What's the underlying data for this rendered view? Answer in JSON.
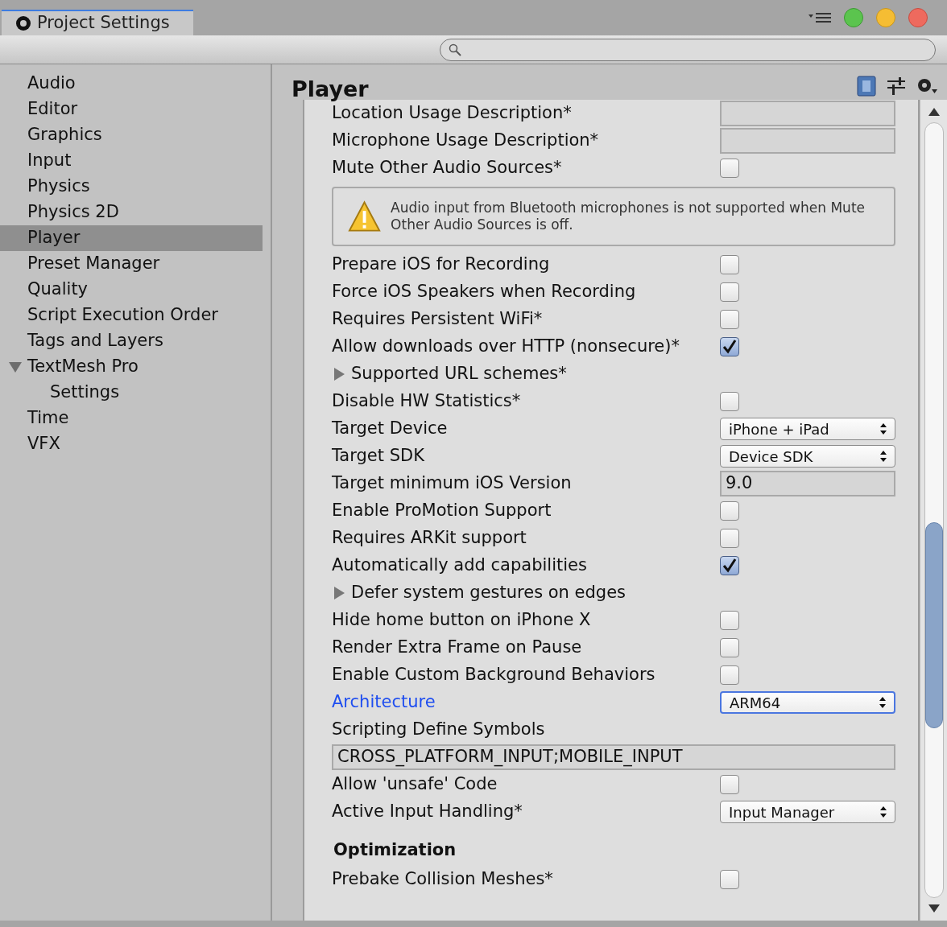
{
  "window": {
    "title": "Project Settings"
  },
  "sidebar": {
    "items": [
      {
        "label": "Audio",
        "selected": false
      },
      {
        "label": "Editor",
        "selected": false
      },
      {
        "label": "Graphics",
        "selected": false
      },
      {
        "label": "Input",
        "selected": false
      },
      {
        "label": "Physics",
        "selected": false
      },
      {
        "label": "Physics 2D",
        "selected": false
      },
      {
        "label": "Player",
        "selected": true
      },
      {
        "label": "Preset Manager",
        "selected": false
      },
      {
        "label": "Quality",
        "selected": false
      },
      {
        "label": "Script Execution Order",
        "selected": false
      },
      {
        "label": "Tags and Layers",
        "selected": false
      },
      {
        "label": "TextMesh Pro",
        "selected": false,
        "expanded": true,
        "children": [
          {
            "label": "Settings",
            "selected": false
          }
        ]
      },
      {
        "label": "Time",
        "selected": false
      },
      {
        "label": "VFX",
        "selected": false
      }
    ]
  },
  "panel": {
    "title": "Player",
    "rows": [
      {
        "kind": "field",
        "label": "Location Usage Description*",
        "value": ""
      },
      {
        "kind": "field",
        "label": "Microphone Usage Description*",
        "value": ""
      },
      {
        "kind": "checkbox",
        "label": "Mute Other Audio Sources*",
        "checked": false
      },
      {
        "kind": "warning",
        "text": "Audio input from Bluetooth microphones is not supported when Mute Other Audio Sources is off."
      },
      {
        "kind": "checkbox",
        "label": "Prepare iOS for Recording",
        "checked": false
      },
      {
        "kind": "checkbox",
        "label": "Force iOS Speakers when Recording",
        "checked": false
      },
      {
        "kind": "checkbox",
        "label": "Requires Persistent WiFi*",
        "checked": false
      },
      {
        "kind": "checkbox",
        "label": "Allow downloads over HTTP (nonsecure)*",
        "checked": true
      },
      {
        "kind": "foldout",
        "label": "Supported URL schemes*",
        "expanded": false
      },
      {
        "kind": "checkbox",
        "label": "Disable HW Statistics*",
        "checked": false
      },
      {
        "kind": "dropdown",
        "label": "Target Device",
        "value": "iPhone + iPad",
        "focused": false
      },
      {
        "kind": "dropdown",
        "label": "Target SDK",
        "value": "Device SDK",
        "focused": false
      },
      {
        "kind": "field",
        "label": "Target minimum iOS Version",
        "value": "9.0"
      },
      {
        "kind": "checkbox",
        "label": "Enable ProMotion Support",
        "checked": false
      },
      {
        "kind": "checkbox",
        "label": "Requires ARKit support",
        "checked": false
      },
      {
        "kind": "checkbox",
        "label": "Automatically add capabilities",
        "checked": true
      },
      {
        "kind": "foldout",
        "label": "Defer system gestures on edges",
        "expanded": false
      },
      {
        "kind": "checkbox",
        "label": "Hide home button on iPhone X",
        "checked": false
      },
      {
        "kind": "checkbox",
        "label": "Render Extra Frame on Pause",
        "checked": false
      },
      {
        "kind": "checkbox",
        "label": "Enable Custom Background Behaviors",
        "checked": false
      },
      {
        "kind": "dropdown",
        "label": "Architecture",
        "value": "ARM64",
        "focused": true
      },
      {
        "kind": "label",
        "label": "Scripting Define Symbols"
      },
      {
        "kind": "wide_field",
        "value": "CROSS_PLATFORM_INPUT;MOBILE_INPUT"
      },
      {
        "kind": "checkbox",
        "label": "Allow 'unsafe' Code",
        "checked": false
      },
      {
        "kind": "dropdown",
        "label": "Active Input Handling*",
        "value": "Input Manager",
        "focused": false
      },
      {
        "kind": "section",
        "label": "Optimization"
      },
      {
        "kind": "checkbox",
        "label": "Prebake Collision Meshes*",
        "checked": false
      }
    ]
  }
}
